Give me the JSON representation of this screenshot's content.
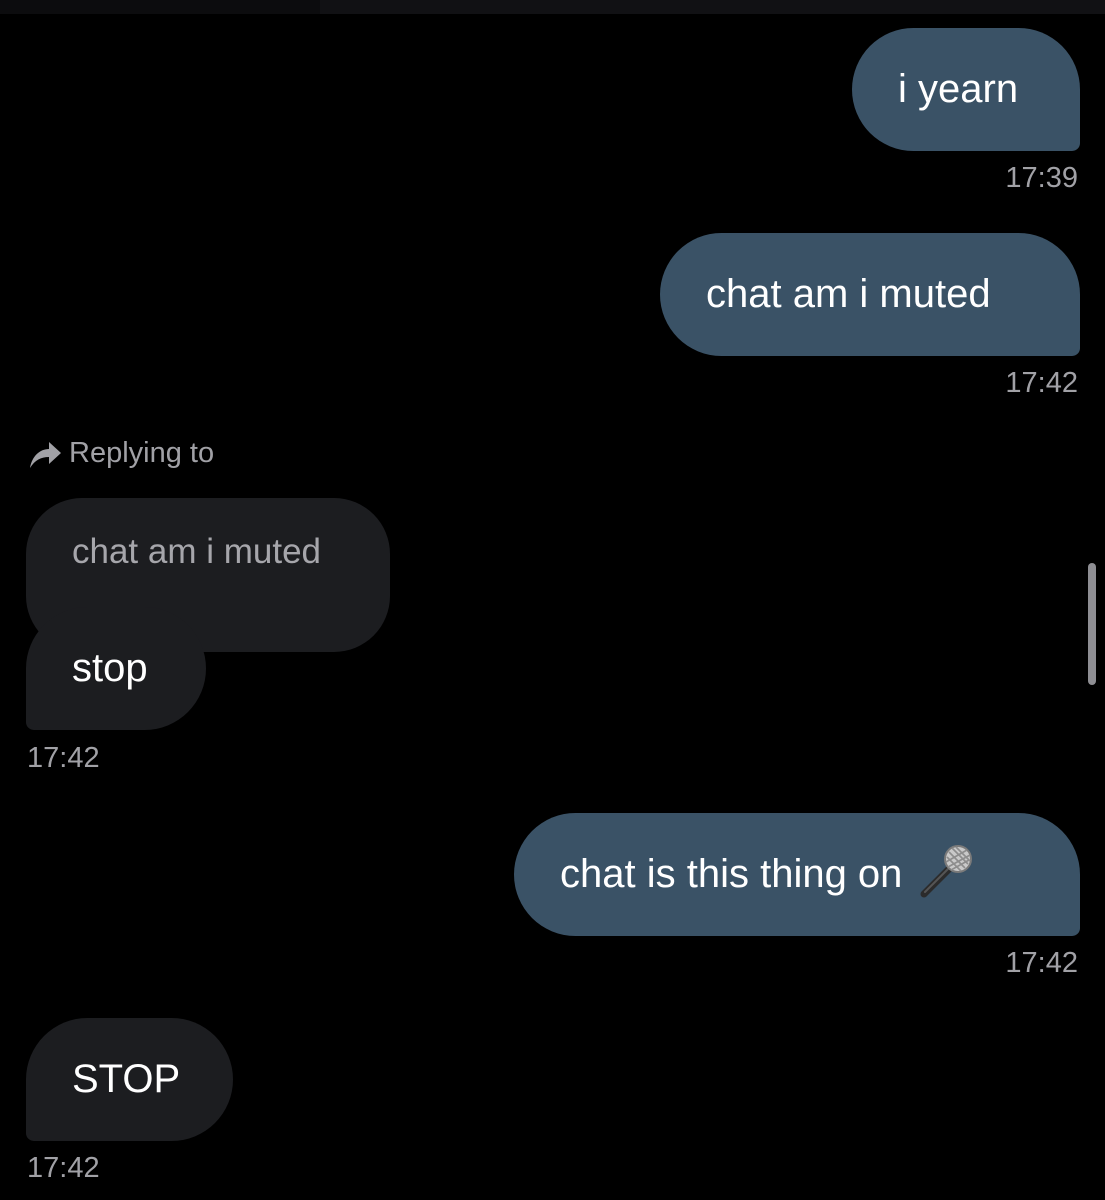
{
  "messages": [
    {
      "id": "m1",
      "text": "i yearn",
      "time": "17:39",
      "direction": "outgoing"
    },
    {
      "id": "m2",
      "text": "chat am i muted",
      "time": "17:42",
      "direction": "outgoing"
    },
    {
      "id": "m3",
      "text": "stop",
      "time": "17:42",
      "direction": "incoming",
      "reply": {
        "label": "Replying to",
        "quoted_text": "chat am i muted"
      }
    },
    {
      "id": "m4",
      "text": "chat is this thing on",
      "emoji_icon": "microphone-icon",
      "time": "17:42",
      "direction": "outgoing"
    },
    {
      "id": "m5",
      "text": "STOP",
      "time": "17:42",
      "direction": "incoming"
    }
  ],
  "colors": {
    "background": "#000000",
    "outgoing_bubble": "#3a5266",
    "incoming_bubble": "#1c1d20",
    "timestamp": "#a1a1a6"
  }
}
